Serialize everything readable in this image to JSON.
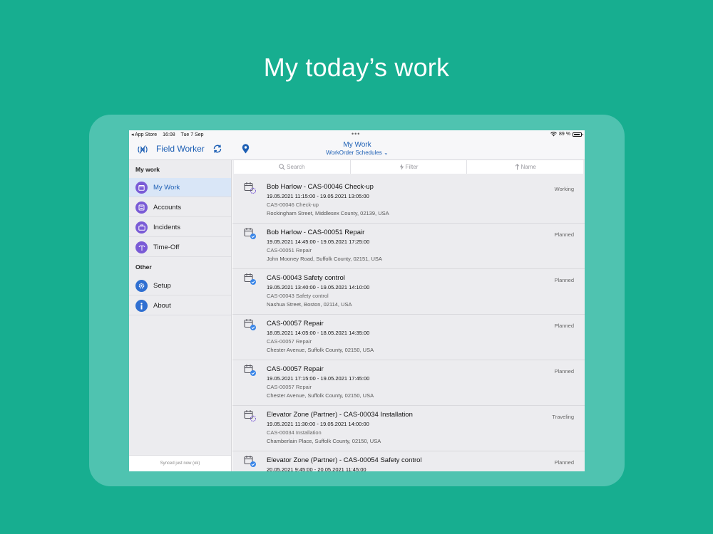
{
  "headline": "My today’s work",
  "status_bar": {
    "back_app": "◂ App Store",
    "time": "16:08",
    "date": "Tue 7 Sep",
    "battery_pct": "89 %"
  },
  "nav": {
    "app_title": "Field Worker",
    "title": "My Work",
    "subtitle": "WorkOrder Schedules ⌄"
  },
  "sidebar": {
    "section_mywork": "My work",
    "items": [
      {
        "label": "My Work",
        "icon": "calendar-icon",
        "color": "#7a5bd6"
      },
      {
        "label": "Accounts",
        "icon": "accounts-icon",
        "color": "#7a5bd6"
      },
      {
        "label": "Incidents",
        "icon": "briefcase-icon",
        "color": "#7a5bd6"
      },
      {
        "label": "Time-Off",
        "icon": "palm-icon",
        "color": "#7a5bd6"
      }
    ],
    "section_other": "Other",
    "other_items": [
      {
        "label": "Setup",
        "icon": "gear-icon",
        "color": "#2f6fd1"
      },
      {
        "label": "About",
        "icon": "info-icon",
        "color": "#2f6fd1"
      }
    ],
    "sync_status": "Synced just now (ok)"
  },
  "toolbar": {
    "search": "Search",
    "filter": "Filter",
    "sort": "Name"
  },
  "rows": [
    {
      "title": "Bob Harlow - CAS-00046 Check-up",
      "time": "19.05.2021 11:15:00 - 19.05.2021 13:05:00",
      "sub": "CAS-00046 Check-up",
      "address": "Rockingham Street, Middlesex County, 02139, USA",
      "status": "Working",
      "icon": "calendar-progress-icon"
    },
    {
      "title": "Bob Harlow - CAS-00051 Repair",
      "time": "19.05.2021 14:45:00 - 19.05.2021 17:25:00",
      "sub": "CAS-00051 Repair",
      "address": "John Mooney Road, Suffolk County, 02151, USA",
      "status": "Planned",
      "icon": "calendar-check-icon"
    },
    {
      "title": "CAS-00043 Safety control",
      "time": "19.05.2021 13:40:00 - 19.05.2021 14:10:00",
      "sub": "CAS-00043 Safety control",
      "address": "Nashua Street, Boston, 02114, USA",
      "status": "Planned",
      "icon": "calendar-check-icon"
    },
    {
      "title": "CAS-00057 Repair",
      "time": "18.05.2021 14:05:00 - 18.05.2021 14:35:00",
      "sub": "CAS-00057 Repair",
      "address": "Chester Avenue, Suffolk County, 02150, USA",
      "status": "Planned",
      "icon": "calendar-check-icon"
    },
    {
      "title": "CAS-00057 Repair",
      "time": "19.05.2021 17:15:00 - 19.05.2021 17:45:00",
      "sub": "CAS-00057 Repair",
      "address": "Chester Avenue, Suffolk County, 02150, USA",
      "status": "Planned",
      "icon": "calendar-check-icon"
    },
    {
      "title": "Elevator Zone (Partner) - CAS-00034 Installation",
      "time": "19.05.2021 11:30:00 - 19.05.2021 14:00:00",
      "sub": "CAS-00034 Installation",
      "address": "Chamberlain Place, Suffolk County, 02150, USA",
      "status": "Traveling",
      "icon": "calendar-progress-icon"
    },
    {
      "title": "Elevator Zone (Partner) - CAS-00054 Safety control",
      "time": "20.05.2021 9:45:00 - 20.05.2021 11:45:00",
      "sub": "",
      "address": "",
      "status": "Planned",
      "icon": "calendar-check-icon"
    }
  ]
}
